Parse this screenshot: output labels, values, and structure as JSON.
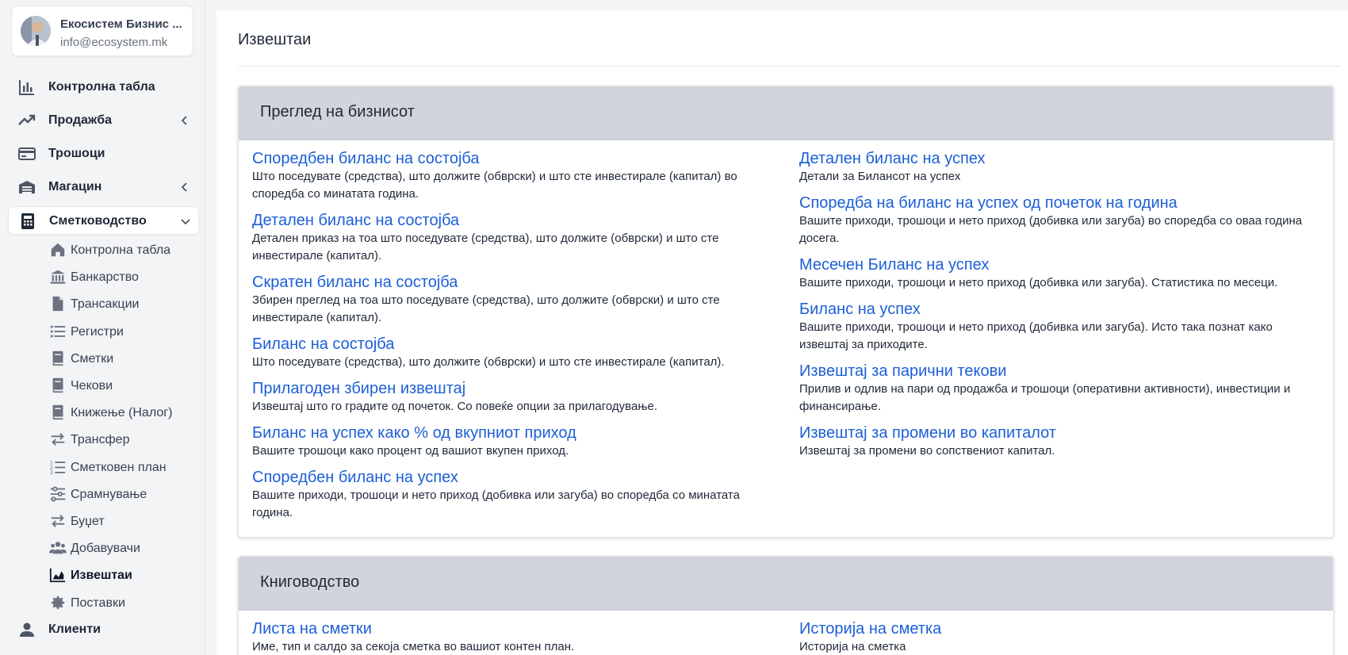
{
  "profile": {
    "name": "Екосистем Бизнис ...",
    "email": "info@ecosystem.mk"
  },
  "nav": {
    "dashboard": "Контролна табла",
    "sales": "Продажба",
    "expenses": "Трошоци",
    "warehouse": "Магацин",
    "accounting": "Сметководство",
    "clients": "Клиенти"
  },
  "accounting_sub": [
    {
      "label": "Контролна табла",
      "icon": "home-icon"
    },
    {
      "label": "Банкарство",
      "icon": "bank-icon"
    },
    {
      "label": "Трансакции",
      "icon": "file-icon"
    },
    {
      "label": "Регистри",
      "icon": "list-icon"
    },
    {
      "label": "Сметки",
      "icon": "book-icon"
    },
    {
      "label": "Чекови",
      "icon": "book-icon"
    },
    {
      "label": "Книжење (Налог)",
      "icon": "book-icon"
    },
    {
      "label": "Трансфер",
      "icon": "transfer-icon"
    },
    {
      "label": "Сметковен план",
      "icon": "ordered-list-icon"
    },
    {
      "label": "Срамнување",
      "icon": "sliders-icon"
    },
    {
      "label": "Буџет",
      "icon": "transfer-icon"
    },
    {
      "label": "Добавувачи",
      "icon": "users-icon"
    },
    {
      "label": "Извештаи",
      "icon": "chart-area-icon"
    },
    {
      "label": "Поставки",
      "icon": "gear-icon"
    }
  ],
  "page": {
    "title": "Извештаи"
  },
  "business_overview": {
    "title": "Преглед на бизнисот",
    "left": [
      {
        "title": "Споредбен биланс на состојба",
        "desc": "Што поседувате (средства), што должите (обврски) и што сте инвестирале (капитал) во споредба со минатата година."
      },
      {
        "title": "Детален биланс на состојба",
        "desc": "Детален приказ на тоа што поседувате (средства), што должите (обврски) и што сте инвестирале (капитал)."
      },
      {
        "title": "Скратен биланс на состојба",
        "desc": "Збирен преглед на тоа што поседувате (средства), што должите (обврски) и што сте инвестирале (капитал)."
      },
      {
        "title": "Биланс на состојба",
        "desc": "Што поседувате (средства), што должите (обврски) и што сте инвестирале (капитал)."
      },
      {
        "title": "Прилагоден збирен извештај",
        "desc": "Извештај што го градите од почеток. Со повеќе опции за прилагодување."
      },
      {
        "title": "Биланс на успех како % од вкупниот приход",
        "desc": "Вашите трошоци како процент од вашиот вкупен приход."
      },
      {
        "title": "Споредбен биланс на успех",
        "desc": "Вашите приходи, трошоци и нето приход (добивка или загуба) во споредба со минатата година."
      }
    ],
    "right": [
      {
        "title": "Детален биланс на успех",
        "desc": "Детали за Билансот на успех"
      },
      {
        "title": "Споредба на биланс на успех од почеток на година",
        "desc": "Вашите приходи, трошоци и нето приход (добивка или загуба) во споредба со оваа година досега."
      },
      {
        "title": "Месечен Биланс на успех",
        "desc": "Вашите приходи, трошоци и нето приход (добивка или загуба). Статистика по месеци."
      },
      {
        "title": "Биланс на успех",
        "desc": "Вашите приходи, трошоци и нето приход (добивка или загуба). Исто така познат како извештај за приходите."
      },
      {
        "title": "Извештај за парични текови",
        "desc": "Прилив и одлив на пари од продажба и трошоци (оперативни активности), инвестиции и финансирање."
      },
      {
        "title": "Извештај за промени во капиталот",
        "desc": "Извештај за промени во сопствениот капитал."
      }
    ]
  },
  "bookkeeping": {
    "title": "Книговодство",
    "left": [
      {
        "title": "Листа на сметки",
        "desc": "Име, тип и салдо за секоја сметка во вашиот контен план."
      }
    ],
    "right": [
      {
        "title": "Историја на сметка",
        "desc": "Историја на сметка"
      }
    ]
  }
}
